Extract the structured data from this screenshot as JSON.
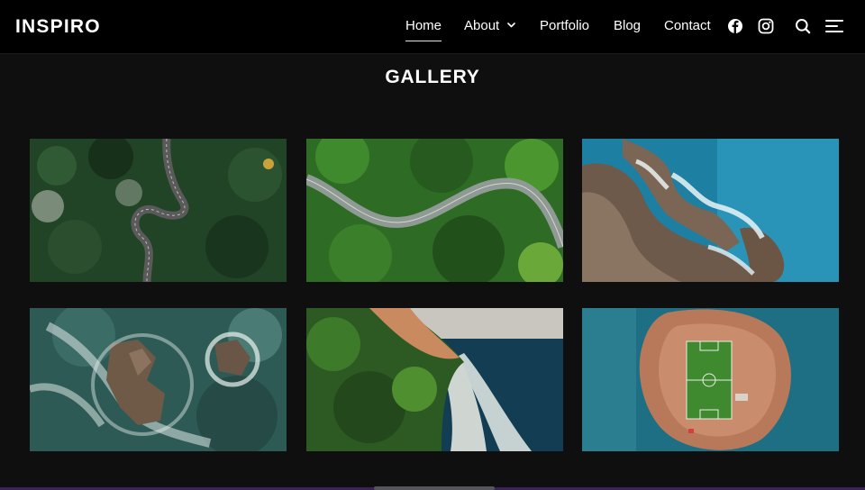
{
  "site": {
    "logo": "INSPIRO"
  },
  "nav": {
    "items": [
      {
        "label": "Home",
        "active": true
      },
      {
        "label": "About",
        "has_dropdown": true
      },
      {
        "label": "Portfolio"
      },
      {
        "label": "Blog"
      },
      {
        "label": "Contact"
      }
    ]
  },
  "header_icons": [
    "facebook-icon",
    "instagram-icon",
    "search-icon",
    "menu-icon"
  ],
  "gallery": {
    "title": "GALLERY",
    "images": [
      {
        "subject": "winding-road-forest"
      },
      {
        "subject": "road-through-forest"
      },
      {
        "subject": "rocky-coast-waves"
      },
      {
        "subject": "rocks-in-surf"
      },
      {
        "subject": "cliff-beach"
      },
      {
        "subject": "island-football-pitch"
      }
    ]
  },
  "colors": {
    "header_bg": "#000000",
    "page_bg": "#0f0f10",
    "text": "#ffffff",
    "bottom_accent": "#3a2457"
  }
}
